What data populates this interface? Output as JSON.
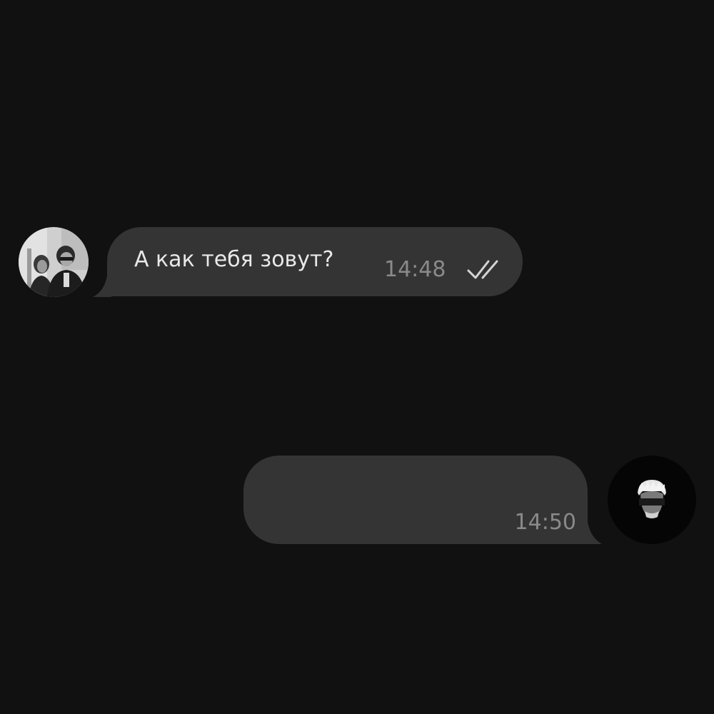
{
  "messages": [
    {
      "direction": "incoming",
      "text": "А как тебя зовут?",
      "time": "14:48",
      "status": "read",
      "status_icon": "double-check-icon"
    },
    {
      "direction": "outgoing",
      "text": "",
      "time": "14:50"
    }
  ],
  "colors": {
    "background": "#111112",
    "bubble": "#343435",
    "text": "#e9e9e9",
    "time": "#8a8a8a"
  }
}
